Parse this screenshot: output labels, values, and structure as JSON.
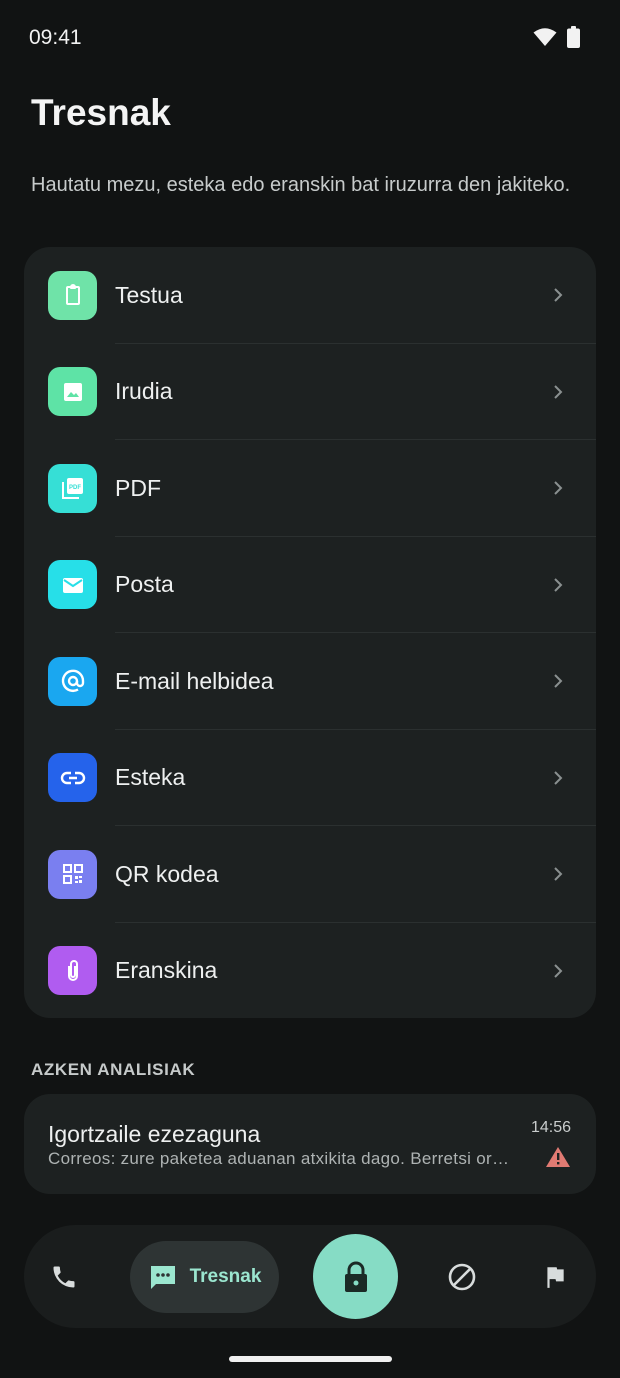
{
  "status_bar": {
    "time": "09:41"
  },
  "header": {
    "title": "Tresnak",
    "subtitle": "Hautatu mezu, esteka edo eranskin bat iruzurra den jakiteko."
  },
  "tools": [
    {
      "label": "Testua",
      "icon": "clipboard-icon",
      "color": "#6fe3a8"
    },
    {
      "label": "Irudia",
      "icon": "image-icon",
      "color": "#5ee3a6"
    },
    {
      "label": "PDF",
      "icon": "pdf-icon",
      "color": "#36dfd6"
    },
    {
      "label": "Posta",
      "icon": "mail-icon",
      "color": "#27dfe8"
    },
    {
      "label": "E-mail helbidea",
      "icon": "at-sign-icon",
      "color": "#1aa7f0"
    },
    {
      "label": "Esteka",
      "icon": "link-icon",
      "color": "#2563eb"
    },
    {
      "label": "QR kodea",
      "icon": "qr-code-icon",
      "color": "#7a7ff0"
    },
    {
      "label": "Eranskina",
      "icon": "paperclip-icon",
      "color": "#b05cf0"
    }
  ],
  "recent": {
    "section_label": "AZKEN ANALISIAK",
    "items": [
      {
        "sender": "Igortzaile ezezaguna",
        "preview": "Correos: zure paketea aduanan atxikita dago. Berretsi ordainketa",
        "time": "14:56",
        "status_icon": "warning-icon",
        "status_color": "#e07a72"
      }
    ]
  },
  "bottom_nav": {
    "active_label": "Tresnak",
    "accent": "#86dcc5",
    "items": [
      "phone-icon",
      "message-icon",
      "lock-icon",
      "block-icon",
      "flag-icon"
    ]
  }
}
